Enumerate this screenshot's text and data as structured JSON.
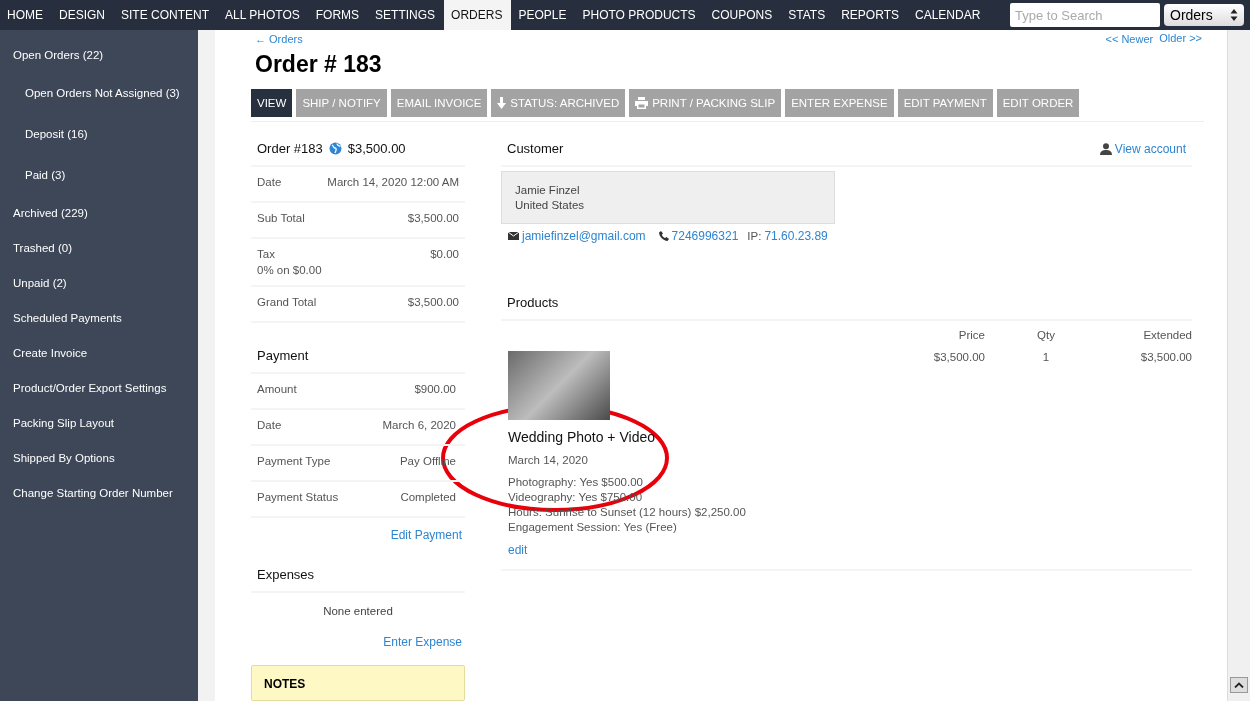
{
  "nav": {
    "tabs": [
      {
        "label": "HOME",
        "selected": false
      },
      {
        "label": "DESIGN",
        "selected": false
      },
      {
        "label": "SITE CONTENT",
        "selected": false
      },
      {
        "label": "ALL PHOTOS",
        "selected": false
      },
      {
        "label": "FORMS",
        "selected": false
      },
      {
        "label": "SETTINGS",
        "selected": false
      },
      {
        "label": "ORDERS",
        "selected": true
      },
      {
        "label": "PEOPLE",
        "selected": false
      },
      {
        "label": "PHOTO PRODUCTS",
        "selected": false
      },
      {
        "label": "COUPONS",
        "selected": false
      },
      {
        "label": "STATS",
        "selected": false
      },
      {
        "label": "REPORTS",
        "selected": false
      },
      {
        "label": "CALENDAR",
        "selected": false
      }
    ],
    "search": {
      "placeholder": "Type to Search"
    },
    "scope": {
      "value": "Orders"
    }
  },
  "sidebar": {
    "items": [
      {
        "label": "Open Orders (22)",
        "children": [
          {
            "label": "Open Orders Not Assigned (3)"
          },
          {
            "label": "Deposit (16)"
          },
          {
            "label": "Paid (3)"
          }
        ]
      },
      {
        "label": "Archived (229)"
      },
      {
        "label": "Trashed (0)"
      },
      {
        "label": "Unpaid (2)"
      },
      {
        "label": "Scheduled Payments"
      },
      {
        "label": "Create Invoice"
      },
      {
        "label": "Product/Order Export Settings"
      },
      {
        "label": "Packing Slip Layout"
      },
      {
        "label": "Shipped By Options"
      },
      {
        "label": "Change Starting Order Number"
      }
    ]
  },
  "back_link": "← Orders",
  "pager": [
    "<< Newer",
    "Older >>"
  ],
  "title": "Order # 183",
  "actions": [
    {
      "label": "VIEW",
      "selected": true
    },
    {
      "label": "SHIP / NOTIFY",
      "selected": false
    },
    {
      "label": "EMAIL INVOICE",
      "selected": false
    },
    {
      "label": "STATUS: ARCHIVED",
      "selected": false,
      "kind": "status"
    },
    {
      "label": "PRINT / PACKING SLIP",
      "selected": false,
      "kind": "print"
    },
    {
      "label": "ENTER EXPENSE",
      "selected": false
    },
    {
      "label": "EDIT PAYMENT",
      "selected": false
    },
    {
      "label": "EDIT ORDER",
      "selected": false
    }
  ],
  "summary": {
    "title": "Order #183",
    "total": "$3,500.00",
    "rows": [
      {
        "label": "Date",
        "value": "March 14, 2020 12:00 AM"
      },
      {
        "label": "Sub Total",
        "value": "$3,500.00"
      },
      {
        "label": "Tax",
        "note": "0% on $0.00",
        "value": "$0.00"
      },
      {
        "label": "Grand Total",
        "value": "$3,500.00"
      }
    ]
  },
  "payment": {
    "title": "Payment",
    "rows": [
      {
        "label": "Amount",
        "value": "$900.00"
      },
      {
        "label": "Date",
        "value": "March 6, 2020"
      },
      {
        "label": "Payment Type",
        "value": "Pay Offline"
      },
      {
        "label": "Payment Status",
        "value": "Completed"
      }
    ],
    "link": "Edit Payment"
  },
  "expenses": {
    "title": "Expenses",
    "empty": "None entered",
    "link": "Enter Expense"
  },
  "notes": {
    "title": "NOTES"
  },
  "customer": {
    "title": "Customer",
    "view_account": "View account",
    "name": "Jamie Finzel",
    "country": "United States",
    "email": "jamiefinzel@gmail.com",
    "phone": "7246996321",
    "ip_label": "IP:",
    "ip": "71.60.23.89"
  },
  "products": {
    "title": "Products",
    "columns": [
      "Price",
      "Qty",
      "Extended"
    ],
    "items": [
      {
        "name": "Wedding Photo + Video",
        "date": "March 14, 2020",
        "options": [
          "Photography: Yes $500.00",
          "Videography: Yes $750.00",
          "Hours: Sunrise to Sunset (12 hours) $2,250.00",
          "Engagement Session: Yes (Free)"
        ],
        "edit": "edit",
        "price": "$3,500.00",
        "qty": "1",
        "extended": "$3,500.00",
        "highlight_circle": true
      }
    ]
  }
}
